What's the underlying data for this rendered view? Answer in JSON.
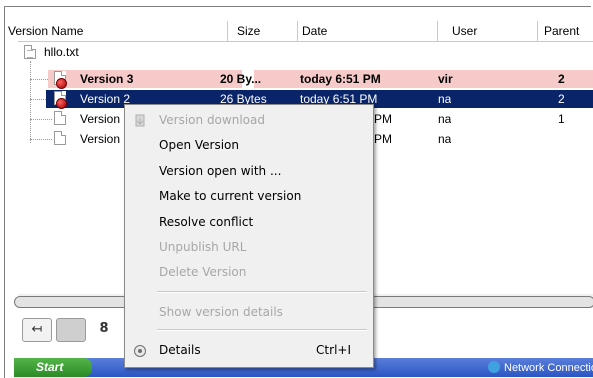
{
  "columns": [
    "Version Name",
    "Size",
    "Date",
    "User",
    "Parent"
  ],
  "file_name": "hllo.txt",
  "rows": [
    {
      "name": "Version 3",
      "size": "20 By...",
      "date": "today 6:51 PM",
      "user": "vir",
      "parent": "2",
      "style": "pink"
    },
    {
      "name": "Version 2",
      "size": "26 Bytes",
      "date": "today 6:51 PM",
      "user": "na",
      "parent": "2",
      "style": "selected"
    },
    {
      "name": "Version",
      "size": "",
      "date": "PM",
      "user": "na",
      "parent": "1",
      "style": "normal"
    },
    {
      "name": "Version",
      "size": "",
      "date": "PM",
      "user": "na",
      "parent": "",
      "style": "normal"
    }
  ],
  "context_menu": {
    "items": [
      {
        "label": "Version download",
        "disabled": true,
        "icon": "download-icon"
      },
      {
        "label": "Open Version",
        "disabled": false
      },
      {
        "label": "Version open with ...",
        "disabled": false
      },
      {
        "label": "Make to current version",
        "disabled": false
      },
      {
        "label": "Resolve conflict",
        "disabled": false
      },
      {
        "label": "Unpublish URL",
        "disabled": true
      },
      {
        "label": "Delete Version",
        "disabled": true
      },
      {
        "label": "Show version details",
        "disabled": true
      },
      {
        "label": "Details",
        "disabled": false,
        "shortcut": "Ctrl+I",
        "icon": "details-icon"
      }
    ]
  },
  "taskbar": {
    "start_label": "Start",
    "item_network": "Network Connectio"
  },
  "colors": {
    "selection": "#0a246a",
    "highlight_row": "#f7caca",
    "menu_bg": "#f0f0f0",
    "disabled_text": "#a7a7a7"
  }
}
